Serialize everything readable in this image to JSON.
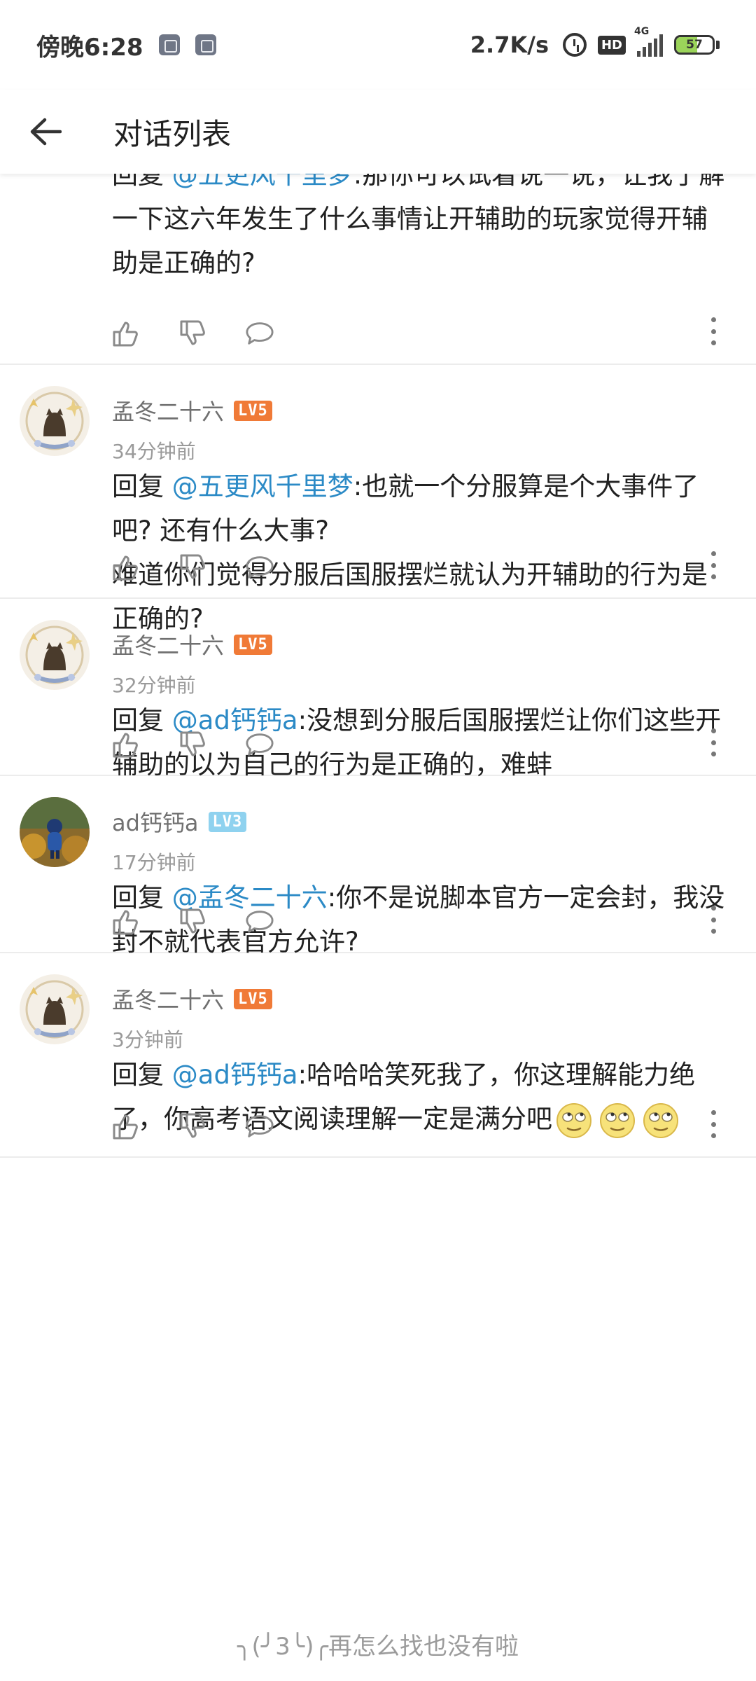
{
  "status_bar": {
    "time": "傍晚6:28",
    "net_speed": "2.7K/s",
    "hd": "HD",
    "network": "4G",
    "battery": "57",
    "battery_level": 0.57
  },
  "header": {
    "title": "对话列表"
  },
  "comments": [
    {
      "prefix": "回复 ",
      "mention": "@五更风千里梦",
      "text": ":那你可以试着说一说，让我了解一下这六年发生了什么事情让开辅助的玩家觉得开辅助是正确的?"
    },
    {
      "username": "孟冬二十六",
      "level": "LV5",
      "time": "34分钟前",
      "prefix": "回复 ",
      "mention": "@五更风千里梦",
      "text": ":也就一个分服算是个大事件了吧? 还有什么大事?",
      "text2": "难道你们觉得分服后国服摆烂就认为开辅助的行为是正确的?"
    },
    {
      "username": "孟冬二十六",
      "level": "LV5",
      "time": "32分钟前",
      "prefix": "回复 ",
      "mention": "@ad钙钙a",
      "text": ":没想到分服后国服摆烂让你们这些开辅助的以为自己的行为是正确的，难蚌"
    },
    {
      "username": "ad钙钙a",
      "level": "LV3",
      "time": "17分钟前",
      "prefix": "回复 ",
      "mention": "@孟冬二十六",
      "text": ":你不是说脚本官方一定会封，我没封不就代表官方允许?"
    },
    {
      "username": "孟冬二十六",
      "level": "LV5",
      "time": "3分钟前",
      "prefix": "回复 ",
      "mention": "@ad钙钙a",
      "text": ":哈哈哈笑死我了，你这理解能力绝了，你高考语文阅读理解一定是满分吧"
    }
  ],
  "footer": {
    "note": "╮(╯3╰)╭再怎么找也没有啦"
  }
}
